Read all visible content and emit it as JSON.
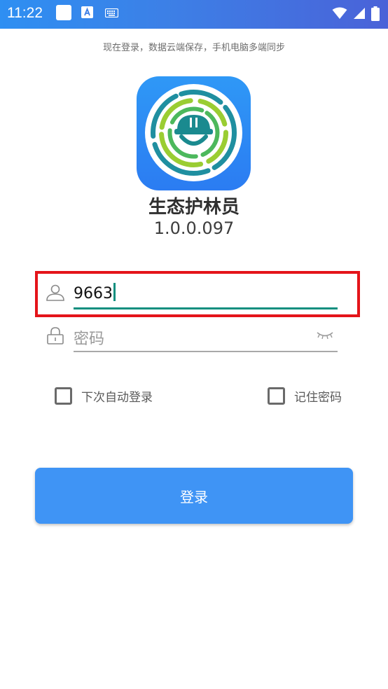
{
  "status_bar": {
    "time": "11:22",
    "notification_icons": [
      "square-app-icon",
      "text-a-icon",
      "keyboard-icon"
    ],
    "system_icons": [
      "wifi-icon",
      "signal-icon",
      "battery-icon"
    ],
    "background_colors": [
      "#2e8ff2",
      "#4a62d8"
    ]
  },
  "tagline": "现在登录，数据云端保存，手机电脑多端同步",
  "app": {
    "name": "生态护林员",
    "version": "1.0.0.097"
  },
  "login_form": {
    "username_value": "9663",
    "password_placeholder": "密码",
    "auto_login_label": "下次自动登录",
    "auto_login_checked": false,
    "remember_password_label": "记住密码",
    "remember_password_checked": false,
    "login_button_label": "登录"
  },
  "colors": {
    "accent_teal": "#0f8f7f",
    "primary_blue": "#3f94f5",
    "highlight_red": "#e4141a"
  }
}
